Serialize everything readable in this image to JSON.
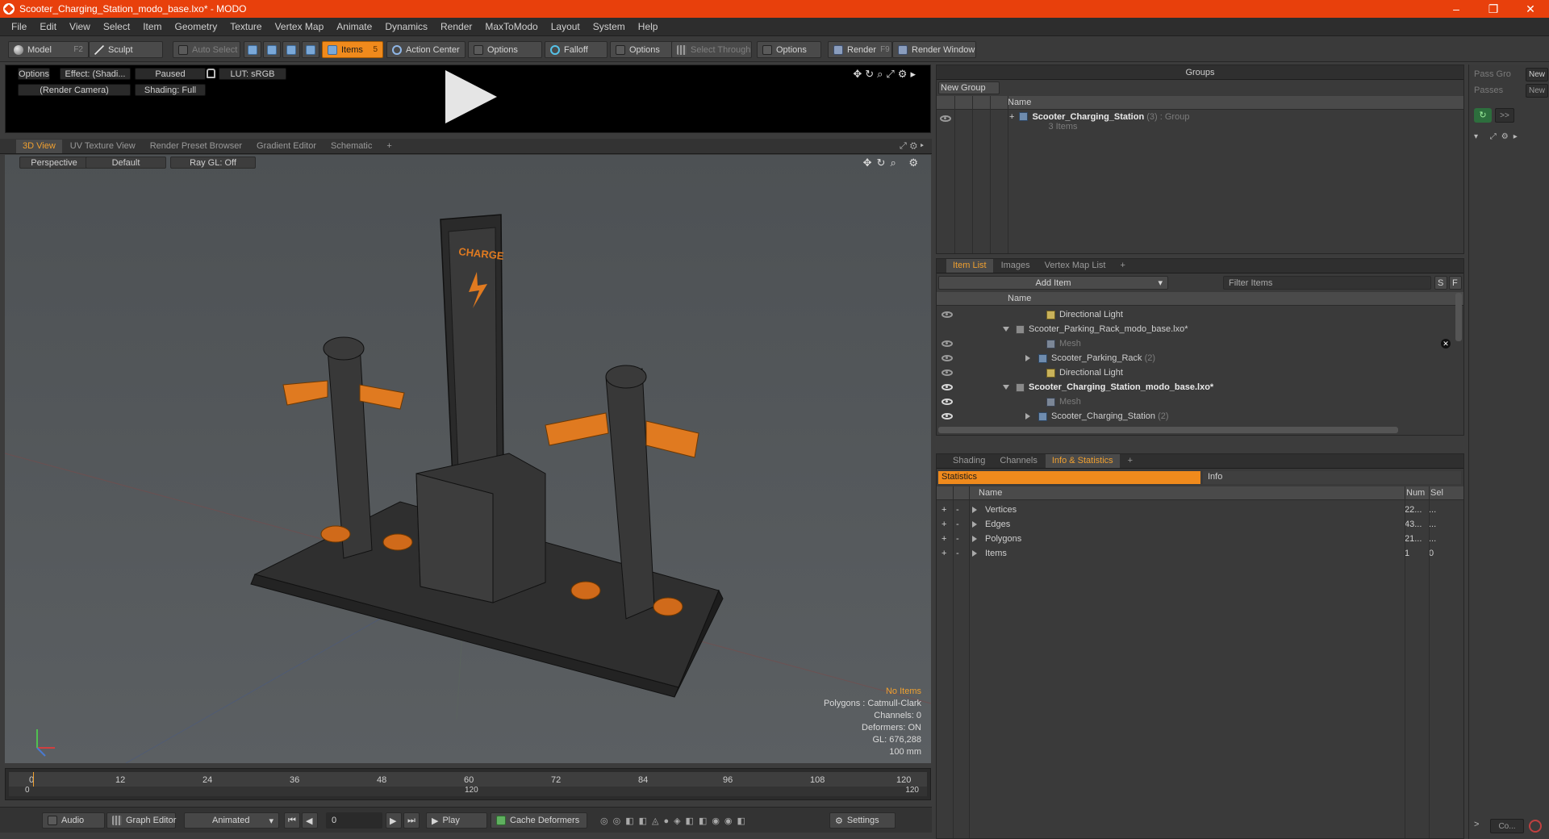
{
  "window": {
    "title": "Scooter_Charging_Station_modo_base.lxo* - MODO",
    "controls": [
      "–",
      "❐",
      "✕"
    ]
  },
  "menu": [
    "File",
    "Edit",
    "View",
    "Select",
    "Item",
    "Geometry",
    "Texture",
    "Vertex Map",
    "Animate",
    "Dynamics",
    "Render",
    "MaxToModo",
    "Layout",
    "System",
    "Help"
  ],
  "toolbar": {
    "model": "Model",
    "model_key": "F2",
    "sculpt": "Sculpt",
    "auto_select": "Auto Select",
    "items": "Items",
    "items_key": "5",
    "action_center": "Action Center",
    "options": "Options",
    "falloff": "Falloff",
    "select_through": "Select Through",
    "render": "Render",
    "render_key": "F9",
    "render_window": "Render Window"
  },
  "preview": {
    "options": "Options",
    "effect": "Effect: (Shadi...",
    "paused": "Paused",
    "lut": "LUT: sRGB",
    "camera": "(Render Camera)",
    "shading": "Shading: Full"
  },
  "viewport_tabs": [
    "3D View",
    "UV Texture View",
    "Render Preset Browser",
    "Gradient Editor",
    "Schematic",
    "+"
  ],
  "viewport": {
    "projection": "Perspective",
    "style": "Default",
    "raygl": "Ray GL: Off",
    "stats": {
      "no_items": "No Items",
      "polygons": "Polygons : Catmull-Clark",
      "channels": "Channels: 0",
      "deformers": "Deformers: ON",
      "gl": "GL: 676,288",
      "unit": "100 mm"
    },
    "sign_text": "CHARGE"
  },
  "timeline": {
    "ticks": [
      "0",
      "12",
      "24",
      "36",
      "48",
      "60",
      "72",
      "84",
      "96",
      "108",
      "120"
    ],
    "start": "0",
    "mid": "120",
    "end": "120"
  },
  "bottombar": {
    "audio": "Audio",
    "graph_editor": "Graph Editor",
    "animated": "Animated",
    "frame": "0",
    "play": "Play",
    "cache": "Cache Deformers",
    "settings": "Settings"
  },
  "groups": {
    "title": "Groups",
    "new_group": "New Group",
    "col_name": "Name",
    "group_name": "Scooter_Charging_Station",
    "group_count": "(3)",
    "group_type": ": Group",
    "group_items": "3 Items"
  },
  "pass": {
    "pass_groups": "Pass Gro",
    "passes": "Passes",
    "new": "New",
    "expand": ">>"
  },
  "itemlist": {
    "tabs": [
      "Item List",
      "Images",
      "Vertex Map List",
      "+"
    ],
    "add_item": "Add Item",
    "filter": "Filter Items",
    "s": "S",
    "f": "F",
    "col_name": "Name",
    "rows": [
      {
        "label": "Directional Light",
        "count": ""
      },
      {
        "label": "Scooter_Parking_Rack_modo_base.lxo*",
        "count": ""
      },
      {
        "label": "Mesh",
        "count": ""
      },
      {
        "label": "Scooter_Parking_Rack",
        "count": "(2)"
      },
      {
        "label": "Directional Light",
        "count": ""
      },
      {
        "label": "Scooter_Charging_Station_modo_base.lxo*",
        "count": ""
      },
      {
        "label": "Mesh",
        "count": ""
      },
      {
        "label": "Scooter_Charging_Station",
        "count": "(2)"
      }
    ]
  },
  "info": {
    "tabs": [
      "Shading",
      "Channels",
      "Info & Statistics",
      "+"
    ],
    "statistics": "Statistics",
    "info": "Info",
    "cols": {
      "name": "Name",
      "num": "Num",
      "sel": "Sel"
    },
    "rows": [
      {
        "name": "Vertices",
        "num": "22...",
        "sel": "..."
      },
      {
        "name": "Edges",
        "num": "43...",
        "sel": "..."
      },
      {
        "name": "Polygons",
        "num": "21...",
        "sel": "..."
      },
      {
        "name": "Items",
        "num": "1",
        "sel": "0"
      }
    ]
  },
  "command": {
    "placeholder": "Co..."
  },
  "colors": {
    "accent": "#f08a1c",
    "title": "#e8400c"
  }
}
